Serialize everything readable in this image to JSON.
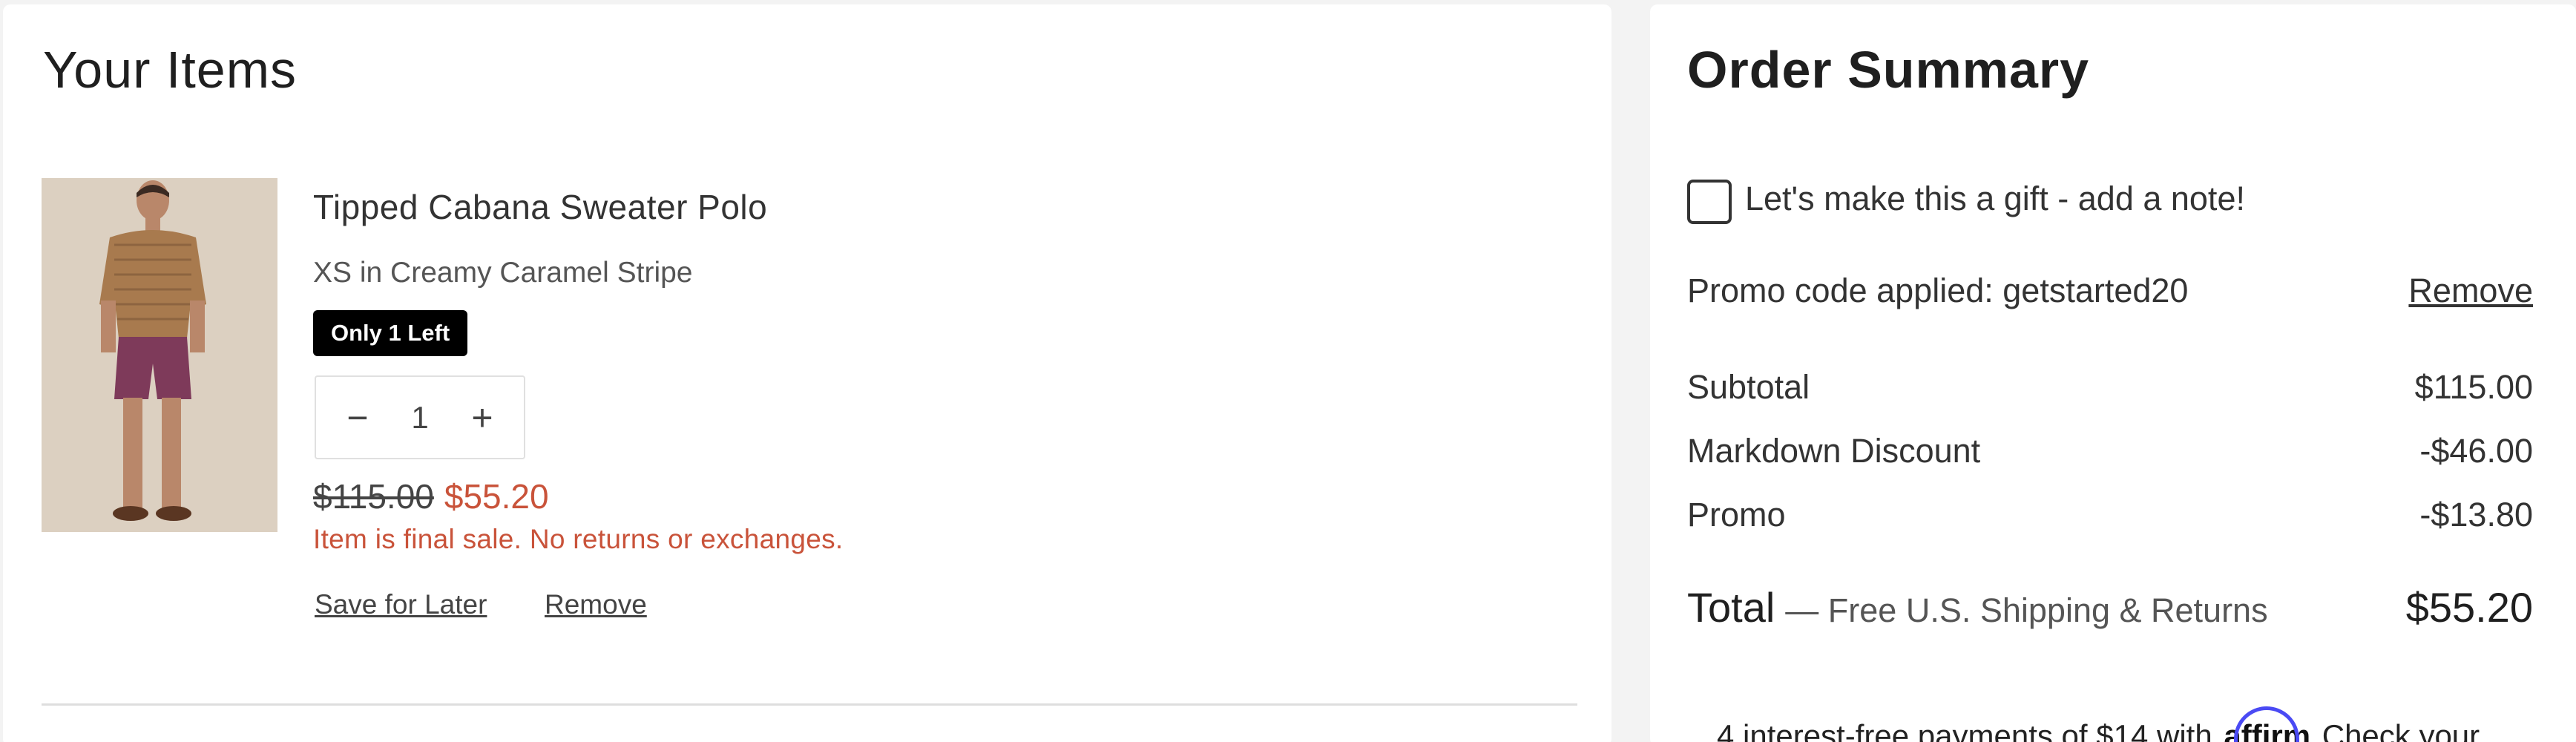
{
  "items_panel": {
    "title": "Your Items",
    "item": {
      "name": "Tipped Cabana Sweater Polo",
      "variant": "XS in Creamy Caramel Stripe",
      "badge": "Only 1 Left",
      "quantity": "1",
      "decrement_icon": "minus-icon",
      "increment_icon": "plus-icon",
      "decrement_symbol": "−",
      "increment_symbol": "+",
      "original_price": "$115.00",
      "sale_price": "$55.20",
      "final_sale_note": "Item is final sale. No returns or exchanges.",
      "save_for_later_label": "Save for Later",
      "remove_label": "Remove"
    }
  },
  "summary_panel": {
    "title": "Order Summary",
    "gift_label": "Let's make this a gift - add a note!",
    "gift_checked": false,
    "promo_text": "Promo code applied: getstarted20",
    "promo_remove_label": "Remove",
    "rows": [
      {
        "label": "Subtotal",
        "value": "$115.00"
      },
      {
        "label": "Markdown Discount",
        "value": "-$46.00"
      },
      {
        "label": "Promo",
        "value": "-$13.80"
      }
    ],
    "total_label": "Total",
    "total_sub": "— Free U.S. Shipping & Returns",
    "total_value": "$55.20",
    "affirm_prefix": "4 interest-free payments of $14 with",
    "affirm_logo": "affirm",
    "affirm_suffix": "Check your"
  },
  "colors": {
    "sale": "#c9533a",
    "badge_bg": "#000000",
    "affirm_arc": "#4a4af4"
  }
}
